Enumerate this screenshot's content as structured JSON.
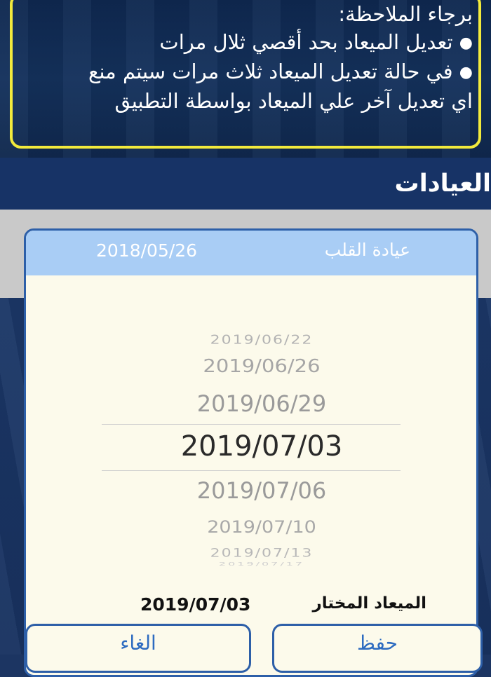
{
  "notice": {
    "heading": "برجاء الملاحظة:",
    "bullets": [
      "تعديل الميعاد بحد أقصي ثلال مرات",
      "في حالة تعديل الميعاد ثلاث مرات سيتم منع",
      "اي تعديل آخر علي الميعاد بواسطة التطبيق"
    ],
    "border_color": "#f2ea3c"
  },
  "section": {
    "title": "العيادات"
  },
  "card": {
    "clinic_name": "عيادة القلب",
    "clinic_date": "2018/05/26",
    "header_color": "#a9cdf5"
  },
  "picker": {
    "options": [
      "2019/06/22",
      "2019/06/26",
      "2019/06/29",
      "2019/07/03",
      "2019/07/06",
      "2019/07/10",
      "2019/07/13",
      "2019/07/17"
    ],
    "selected": "2019/07/03"
  },
  "selection": {
    "label": "الميعاد المختار",
    "value": "2019/07/03"
  },
  "buttons": {
    "cancel": "الغاء",
    "save": "حفظ"
  }
}
